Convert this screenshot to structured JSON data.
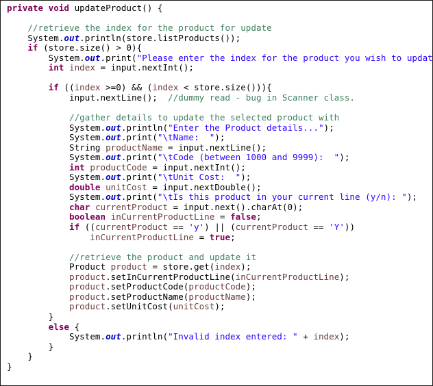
{
  "editor": {
    "language": "Java",
    "method_name": "updateProduct",
    "background_color": "#ffffff",
    "border_color": "#1b1b1b",
    "token_colors": {
      "keyword": "#7f0055",
      "string": "#2a00ff",
      "comment": "#3f7f5f",
      "static_field": "#0000c0",
      "local_variable": "#6a3e3e",
      "plain": "#000000"
    }
  },
  "code": {
    "lines": [
      [
        {
          "t": "private",
          "c": "kw"
        },
        {
          "t": " ",
          "c": "plain"
        },
        {
          "t": "void",
          "c": "kw"
        },
        {
          "t": " updateProduct() {",
          "c": "plain"
        }
      ],
      [],
      [
        {
          "t": "    ",
          "c": "plain"
        },
        {
          "t": "//retrieve the index for the product for update",
          "c": "cmt"
        }
      ],
      [
        {
          "t": "    System.",
          "c": "plain"
        },
        {
          "t": "out",
          "c": "fld"
        },
        {
          "t": ".println(store.listProducts());",
          "c": "plain"
        }
      ],
      [
        {
          "t": "    ",
          "c": "plain"
        },
        {
          "t": "if",
          "c": "kw"
        },
        {
          "t": " (store.size() > ",
          "c": "plain"
        },
        {
          "t": "0",
          "c": "plain"
        },
        {
          "t": "){",
          "c": "plain"
        }
      ],
      [
        {
          "t": "        System.",
          "c": "plain"
        },
        {
          "t": "out",
          "c": "fld"
        },
        {
          "t": ".print(",
          "c": "plain"
        },
        {
          "t": "\"Please enter the index for the product you wish to update: \"",
          "c": "str"
        },
        {
          "t": ");",
          "c": "plain"
        }
      ],
      [
        {
          "t": "        ",
          "c": "plain"
        },
        {
          "t": "int",
          "c": "kw"
        },
        {
          "t": " ",
          "c": "plain"
        },
        {
          "t": "index",
          "c": "loc"
        },
        {
          "t": " = input.nextInt();",
          "c": "plain"
        }
      ],
      [],
      [
        {
          "t": "        ",
          "c": "plain"
        },
        {
          "t": "if",
          "c": "kw"
        },
        {
          "t": " ((",
          "c": "plain"
        },
        {
          "t": "index",
          "c": "loc"
        },
        {
          "t": " >=",
          "c": "plain"
        },
        {
          "t": "0",
          "c": "plain"
        },
        {
          "t": ") && (",
          "c": "plain"
        },
        {
          "t": "index",
          "c": "loc"
        },
        {
          "t": " < store.size())){",
          "c": "plain"
        }
      ],
      [
        {
          "t": "            input.nextLine();  ",
          "c": "plain"
        },
        {
          "t": "//dummy read - bug in Scanner class.",
          "c": "cmt"
        }
      ],
      [],
      [
        {
          "t": "            ",
          "c": "plain"
        },
        {
          "t": "//gather details to update the selected product with",
          "c": "cmt"
        }
      ],
      [
        {
          "t": "            System.",
          "c": "plain"
        },
        {
          "t": "out",
          "c": "fld"
        },
        {
          "t": ".println(",
          "c": "plain"
        },
        {
          "t": "\"Enter the Product details...\"",
          "c": "str"
        },
        {
          "t": ");",
          "c": "plain"
        }
      ],
      [
        {
          "t": "            System.",
          "c": "plain"
        },
        {
          "t": "out",
          "c": "fld"
        },
        {
          "t": ".print(",
          "c": "plain"
        },
        {
          "t": "\"\\tName:  \"",
          "c": "str"
        },
        {
          "t": ");",
          "c": "plain"
        }
      ],
      [
        {
          "t": "            String ",
          "c": "plain"
        },
        {
          "t": "productName",
          "c": "loc"
        },
        {
          "t": " = input.nextLine();",
          "c": "plain"
        }
      ],
      [
        {
          "t": "            System.",
          "c": "plain"
        },
        {
          "t": "out",
          "c": "fld"
        },
        {
          "t": ".print(",
          "c": "plain"
        },
        {
          "t": "\"\\tCode (between 1000 and 9999):  \"",
          "c": "str"
        },
        {
          "t": ");",
          "c": "plain"
        }
      ],
      [
        {
          "t": "            ",
          "c": "plain"
        },
        {
          "t": "int",
          "c": "kw"
        },
        {
          "t": " ",
          "c": "plain"
        },
        {
          "t": "productCode",
          "c": "loc"
        },
        {
          "t": " = input.nextInt();",
          "c": "plain"
        }
      ],
      [
        {
          "t": "            System.",
          "c": "plain"
        },
        {
          "t": "out",
          "c": "fld"
        },
        {
          "t": ".print(",
          "c": "plain"
        },
        {
          "t": "\"\\tUnit Cost:  \"",
          "c": "str"
        },
        {
          "t": ");",
          "c": "plain"
        }
      ],
      [
        {
          "t": "            ",
          "c": "plain"
        },
        {
          "t": "double",
          "c": "kw"
        },
        {
          "t": " ",
          "c": "plain"
        },
        {
          "t": "unitCost",
          "c": "loc"
        },
        {
          "t": " = input.nextDouble();",
          "c": "plain"
        }
      ],
      [
        {
          "t": "            System.",
          "c": "plain"
        },
        {
          "t": "out",
          "c": "fld"
        },
        {
          "t": ".print(",
          "c": "plain"
        },
        {
          "t": "\"\\tIs this product in your current line (y/n): \"",
          "c": "str"
        },
        {
          "t": ");",
          "c": "plain"
        }
      ],
      [
        {
          "t": "            ",
          "c": "plain"
        },
        {
          "t": "char",
          "c": "kw"
        },
        {
          "t": " ",
          "c": "plain"
        },
        {
          "t": "currentProduct",
          "c": "loc"
        },
        {
          "t": " = input.next().charAt(",
          "c": "plain"
        },
        {
          "t": "0",
          "c": "plain"
        },
        {
          "t": ");",
          "c": "plain"
        }
      ],
      [
        {
          "t": "            ",
          "c": "plain"
        },
        {
          "t": "boolean",
          "c": "kw"
        },
        {
          "t": " ",
          "c": "plain"
        },
        {
          "t": "inCurrentProductLine",
          "c": "loc"
        },
        {
          "t": " = ",
          "c": "plain"
        },
        {
          "t": "false",
          "c": "kw"
        },
        {
          "t": ";",
          "c": "plain"
        }
      ],
      [
        {
          "t": "            ",
          "c": "plain"
        },
        {
          "t": "if",
          "c": "kw"
        },
        {
          "t": " ((",
          "c": "plain"
        },
        {
          "t": "currentProduct",
          "c": "loc"
        },
        {
          "t": " == ",
          "c": "plain"
        },
        {
          "t": "'y'",
          "c": "str"
        },
        {
          "t": ") || (",
          "c": "plain"
        },
        {
          "t": "currentProduct",
          "c": "loc"
        },
        {
          "t": " == ",
          "c": "plain"
        },
        {
          "t": "'Y'",
          "c": "str"
        },
        {
          "t": "))",
          "c": "plain"
        }
      ],
      [
        {
          "t": "                ",
          "c": "plain"
        },
        {
          "t": "inCurrentProductLine",
          "c": "loc"
        },
        {
          "t": " = ",
          "c": "plain"
        },
        {
          "t": "true",
          "c": "kw"
        },
        {
          "t": ";",
          "c": "plain"
        }
      ],
      [],
      [
        {
          "t": "            ",
          "c": "plain"
        },
        {
          "t": "//retrieve the product and update it",
          "c": "cmt"
        }
      ],
      [
        {
          "t": "            Product ",
          "c": "plain"
        },
        {
          "t": "product",
          "c": "loc"
        },
        {
          "t": " = store.get(",
          "c": "plain"
        },
        {
          "t": "index",
          "c": "loc"
        },
        {
          "t": ");",
          "c": "plain"
        }
      ],
      [
        {
          "t": "            ",
          "c": "plain"
        },
        {
          "t": "product",
          "c": "loc"
        },
        {
          "t": ".setInCurrentProductLine(",
          "c": "plain"
        },
        {
          "t": "inCurrentProductLine",
          "c": "loc"
        },
        {
          "t": ");",
          "c": "plain"
        }
      ],
      [
        {
          "t": "            ",
          "c": "plain"
        },
        {
          "t": "product",
          "c": "loc"
        },
        {
          "t": ".setProductCode(",
          "c": "plain"
        },
        {
          "t": "productCode",
          "c": "loc"
        },
        {
          "t": ");",
          "c": "plain"
        }
      ],
      [
        {
          "t": "            ",
          "c": "plain"
        },
        {
          "t": "product",
          "c": "loc"
        },
        {
          "t": ".setProductName(",
          "c": "plain"
        },
        {
          "t": "productName",
          "c": "loc"
        },
        {
          "t": ");",
          "c": "plain"
        }
      ],
      [
        {
          "t": "            ",
          "c": "plain"
        },
        {
          "t": "product",
          "c": "loc"
        },
        {
          "t": ".setUnitCost(",
          "c": "plain"
        },
        {
          "t": "unitCost",
          "c": "loc"
        },
        {
          "t": ");",
          "c": "plain"
        }
      ],
      [
        {
          "t": "        }",
          "c": "plain"
        }
      ],
      [
        {
          "t": "        ",
          "c": "plain"
        },
        {
          "t": "else",
          "c": "kw"
        },
        {
          "t": " {",
          "c": "plain"
        }
      ],
      [
        {
          "t": "            System.",
          "c": "plain"
        },
        {
          "t": "out",
          "c": "fld"
        },
        {
          "t": ".println(",
          "c": "plain"
        },
        {
          "t": "\"Invalid index entered: \"",
          "c": "str"
        },
        {
          "t": " + ",
          "c": "plain"
        },
        {
          "t": "index",
          "c": "loc"
        },
        {
          "t": ");",
          "c": "plain"
        }
      ],
      [
        {
          "t": "        }",
          "c": "plain"
        }
      ],
      [
        {
          "t": "    }",
          "c": "plain"
        }
      ],
      [
        {
          "t": "}",
          "c": "plain"
        }
      ]
    ]
  }
}
